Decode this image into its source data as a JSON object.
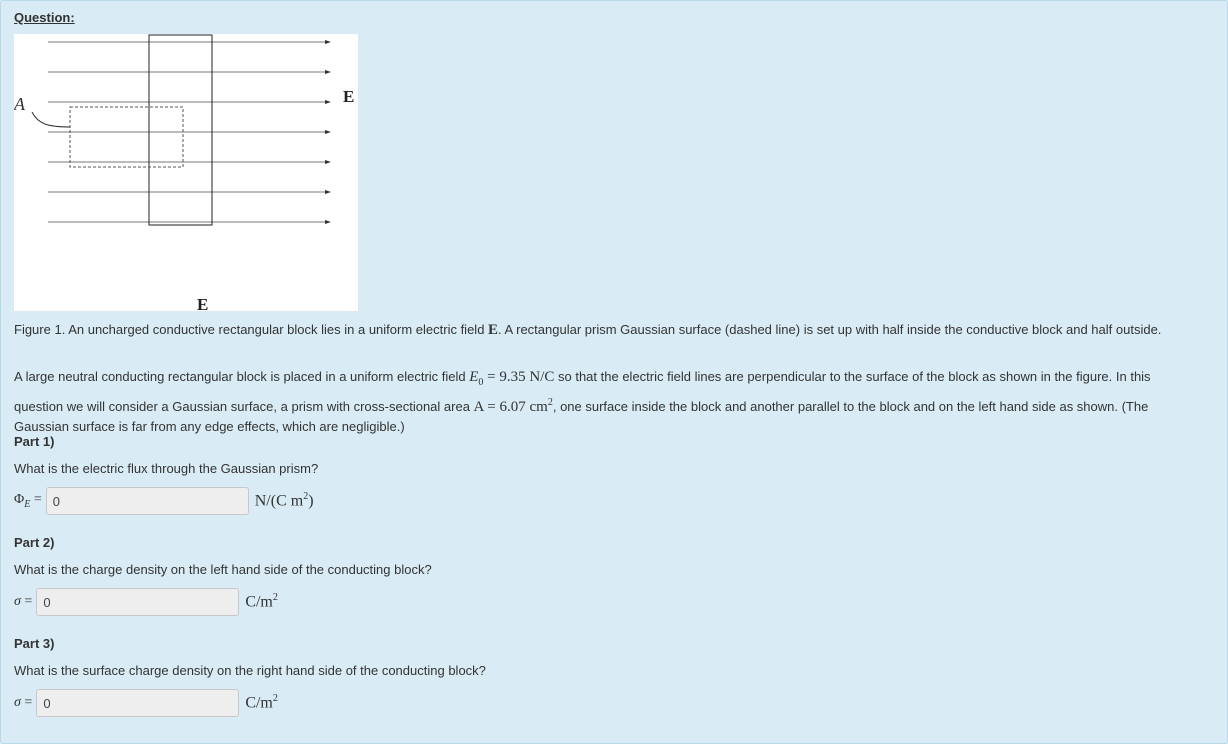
{
  "question_label": "Question:",
  "figure": {
    "label_A": "A",
    "label_E_right": "E",
    "label_E_bottom": "E"
  },
  "caption": {
    "pre": "Figure 1. An uncharged conductive rectangular block lies in a uniform electric field ",
    "field_symbol": "E",
    "post": ". A rectangular prism Gaussian surface (dashed line) is set up with half inside the conductive block and half outside."
  },
  "problem": {
    "text1": "A large neutral conducting rectangular block is placed in a uniform electric field ",
    "e0_symbol": "E",
    "e0_sub": "0",
    "e0_value": " = 9.35 N/C",
    "text2": " so that the electric field lines are perpendicular to the surface of the block as shown in the figure. In this question we will consider a Gaussian surface, a prism with cross-sectional area ",
    "area_value": "A = 6.07 cm",
    "area_exp": "2",
    "text3": ", one surface inside the block and another parallel to the block and on the left hand side as shown. (The Gaussian surface is far from any edge effects, which are negligible.)"
  },
  "parts": [
    {
      "title": "Part 1)",
      "question": "What is the electric flux through the Gaussian prism?",
      "label": "Φ",
      "label_sub": "E",
      "label_eq": " =",
      "value": "0",
      "unit": "N/(C m",
      "unit_exp": "2",
      "unit_tail": ")"
    },
    {
      "title": "Part 2)",
      "question": "What is the charge density on the left hand side of the conducting block?",
      "label": "σ",
      "label_sub": "",
      "label_eq": " =",
      "value": "0",
      "unit": "C/m",
      "unit_exp": "2",
      "unit_tail": ""
    },
    {
      "title": "Part 3)",
      "question": "What is the surface charge density on the right hand side of the conducting block?",
      "label": "σ",
      "label_sub": "",
      "label_eq": " =",
      "value": "0",
      "unit": "C/m",
      "unit_exp": "2",
      "unit_tail": ""
    }
  ]
}
